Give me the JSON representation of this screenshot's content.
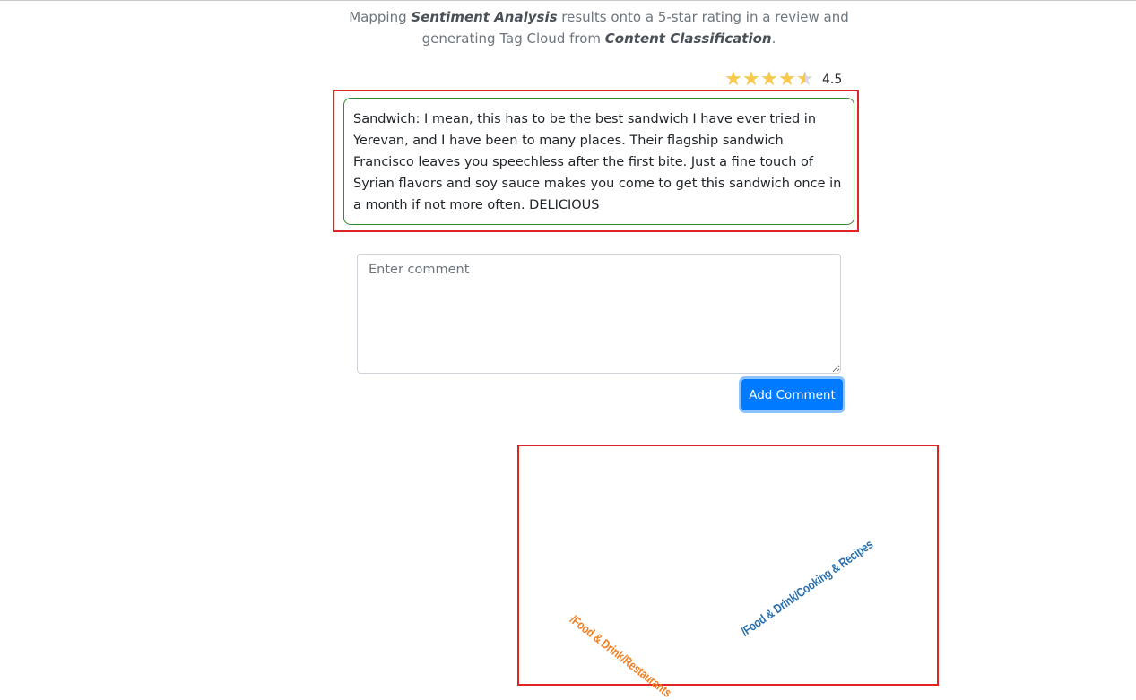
{
  "intro": {
    "part1": "Mapping ",
    "emph1": "Sentiment Analysis",
    "part2": " results onto a 5-star rating in a review and generating Tag Cloud from ",
    "emph2": "Content Classification",
    "part3": "."
  },
  "rating": {
    "value": "4.5",
    "score": 4.5,
    "max_stars": 5,
    "star_color": "#f7ca4f",
    "empty_color": "#d9d9d9"
  },
  "review": {
    "text": "Sandwich: I mean, this has to be the best sandwich I have ever tried in Yerevan, and I have been to many places. Their flagship sandwich Francisco leaves you speechless after the first bite. Just a fine touch of Syrian flavors and soy sauce makes you come to get this sandwich once in a month if not more often. DELICIOUS",
    "border_color": "#2e8b2e"
  },
  "comment": {
    "placeholder": "Enter comment",
    "value": ""
  },
  "add_button": {
    "label": "Add Comment",
    "color": "#007bff"
  },
  "tag_cloud": {
    "tags": [
      {
        "label": "/Food & Drink/Restaurants",
        "color": "#f07f22"
      },
      {
        "label": "/Food & Drink/Cooking & Recipes",
        "color": "#2a6fad"
      }
    ]
  },
  "highlight_color": "#e02424"
}
